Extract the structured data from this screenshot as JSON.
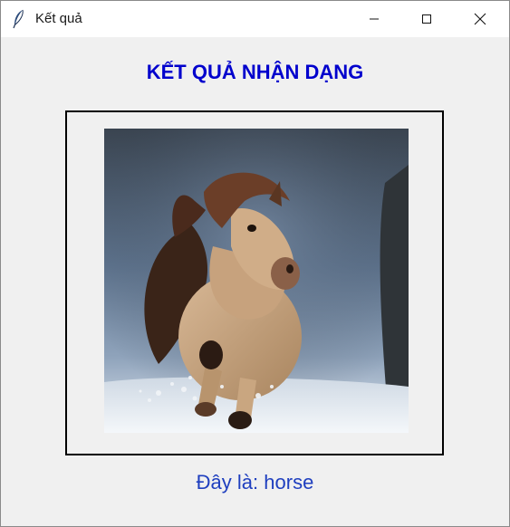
{
  "window": {
    "title": "Kết quả",
    "icon": "feather-icon",
    "controls": [
      "minimize-icon",
      "maximize-icon",
      "close-icon"
    ]
  },
  "main": {
    "heading": "KẾT QUẢ NHẬN DẠNG",
    "image_alt": "horse",
    "result_prefix": "Đây là:",
    "result_value": "horse"
  },
  "colors": {
    "heading": "#0000cd",
    "result": "#1f3fbf",
    "window_bg": "#f0f0f0",
    "frame_border": "#000000"
  }
}
